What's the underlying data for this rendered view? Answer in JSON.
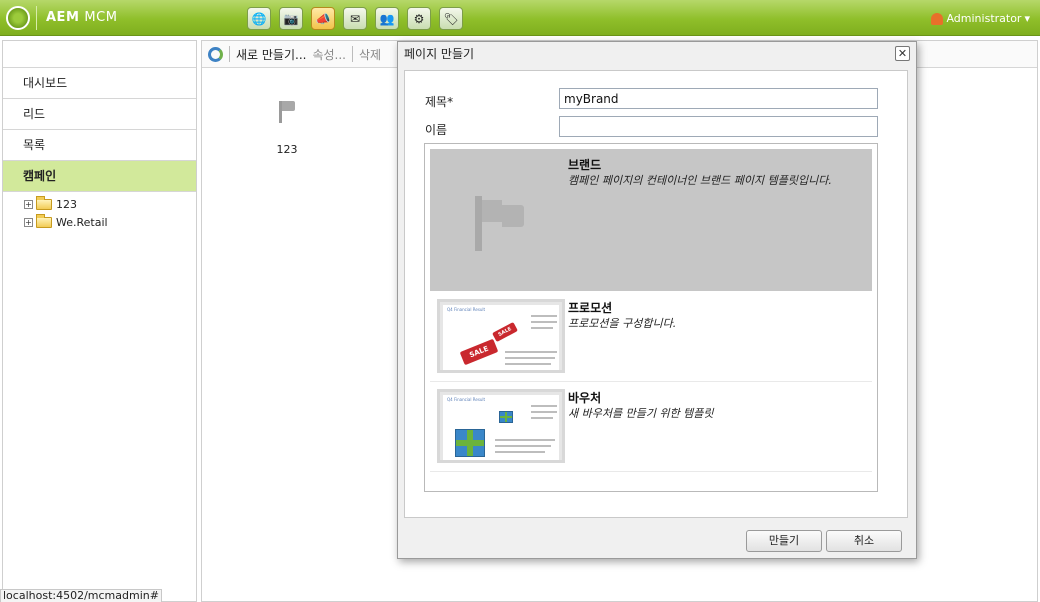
{
  "app": {
    "title_bold": "AEM",
    "title_light": "MCM"
  },
  "nav_icons": [
    {
      "icon": "globe-icon",
      "glyph": "🌐",
      "active": false
    },
    {
      "icon": "camera-icon",
      "glyph": "📷",
      "active": false
    },
    {
      "icon": "megaphone-icon",
      "glyph": "📣",
      "active": true
    },
    {
      "icon": "mail-icon",
      "glyph": "✉",
      "active": false
    },
    {
      "icon": "users-icon",
      "glyph": "👥",
      "active": false
    },
    {
      "icon": "gear-icon",
      "glyph": "⚙",
      "active": false
    },
    {
      "icon": "tag-icon",
      "glyph": "🏷",
      "active": false
    }
  ],
  "user": {
    "name": "Administrator"
  },
  "sidebar": {
    "items": [
      {
        "label": "대시보드"
      },
      {
        "label": "리드"
      },
      {
        "label": "목록"
      },
      {
        "label": "캠페인"
      }
    ],
    "tree": [
      {
        "label": "123"
      },
      {
        "label": "We.Retail"
      }
    ]
  },
  "toolbar": {
    "new_label": "새로 만들기...",
    "properties_label": "속성...",
    "delete_label": "삭제"
  },
  "grid": {
    "item_label": "123"
  },
  "dialog": {
    "title": "페이지 만들기",
    "close_glyph": "✕",
    "title_label": "제목*",
    "title_value": "myBrand",
    "name_label": "이름",
    "name_value": "",
    "templates": [
      {
        "title": "브랜드",
        "description": "캠페인 페이지의 컨테이너인 브랜드 페이지 템플릿입니다."
      },
      {
        "title": "프로모션",
        "description": "프로모션을 구성합니다.",
        "thumb_heading": "Q4 Financial Result",
        "thumb_text": "condimentum ipsum et dolor. Aenean dol. Cras eget diam. Phasellus vitae magna. Sed dolum.",
        "sale_label": "SALE"
      },
      {
        "title": "바우처",
        "description": "새 바우처를 만들기 위한 템플릿",
        "thumb_heading": "Q4 Financial Result",
        "thumb_text": "condimentum ipsum et dolor. Aenean dol. Cras eget diam. Phasellus vitae magna. Sed dolum."
      }
    ],
    "create_label": "만들기",
    "cancel_label": "취소"
  },
  "statusbar": {
    "url": "localhost:4502/mcmadmin#"
  }
}
